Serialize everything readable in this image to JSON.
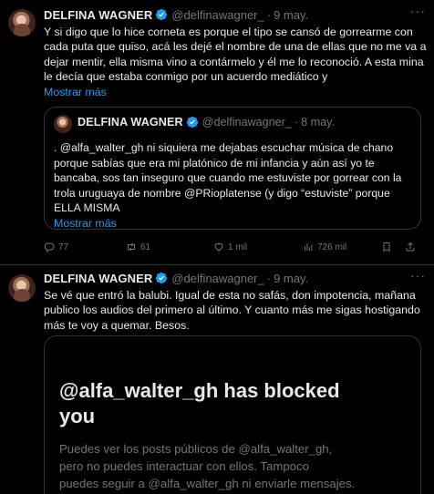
{
  "tweets": [
    {
      "author": {
        "name": "DELFINA WAGNER",
        "handle": "@delfinawagner_",
        "verified": true
      },
      "time": "9 may.",
      "text_lines": [
        "Y si digo que lo hice corneta es porque el tipo se cansó de gorrearme con",
        "cada puta que quiso, acá les dejé el nombre de una de ellas que no me va a",
        "dejar mentir, ella misma vino a contármelo y él me lo reconoció. A esta mina",
        "le decía que estaba conmigo por un acuerdo mediático y"
      ],
      "show_more": "Mostrar más",
      "quote": {
        "author": {
          "name": "DELFINA WAGNER",
          "handle": "@delfinawagner_",
          "verified": true
        },
        "time": "8 may.",
        "text_lines": [
          ". @alfa_walter_gh ni siquiera me dejabas escuchar música de chano",
          "porque sabías que era mi platónico de mi infancia y aún así yo te",
          "bancaba, sos tan inseguro que cuando me estuviste por gorrear con la",
          "trola uruguaya de nombre @PRioplatense  (y digo “estuviste” porque",
          "ELLA MISMA"
        ],
        "show_more": "Mostrar más"
      },
      "actions": {
        "replies": "77",
        "reposts": "61",
        "likes": "1 mil",
        "views": "726 mil"
      }
    },
    {
      "author": {
        "name": "DELFINA WAGNER",
        "handle": "@delfinawagner_",
        "verified": true
      },
      "time": "9 may.",
      "text_lines": [
        "Se vé que entró la balubi. Igual de esta no safás, don impotencia, mañana",
        "publico los audios del primero al último. Y cuanto más me sigas hostigando",
        "más te voy a quemar. Besos."
      ],
      "media": {
        "title_lines": [
          "@alfa_walter_gh has blocked",
          "you"
        ],
        "text_lines": [
          "Puedes ver los posts públicos de @alfa_walter_gh,",
          "pero no puedes interactuar con ellos. Tampoco",
          "puedes seguir a @alfa_walter_gh ni enviarle mensajes."
        ]
      }
    }
  ],
  "colors": {
    "background": "#000000",
    "text": "#e7e9ea",
    "muted": "#71767b",
    "link": "#1d9bf0",
    "border": "#2f3336",
    "verified": "#1d9bf0"
  },
  "icons": [
    "verified-badge-icon",
    "more-icon",
    "reply-icon",
    "repost-icon",
    "like-icon",
    "views-icon",
    "bookmark-icon",
    "share-icon"
  ]
}
